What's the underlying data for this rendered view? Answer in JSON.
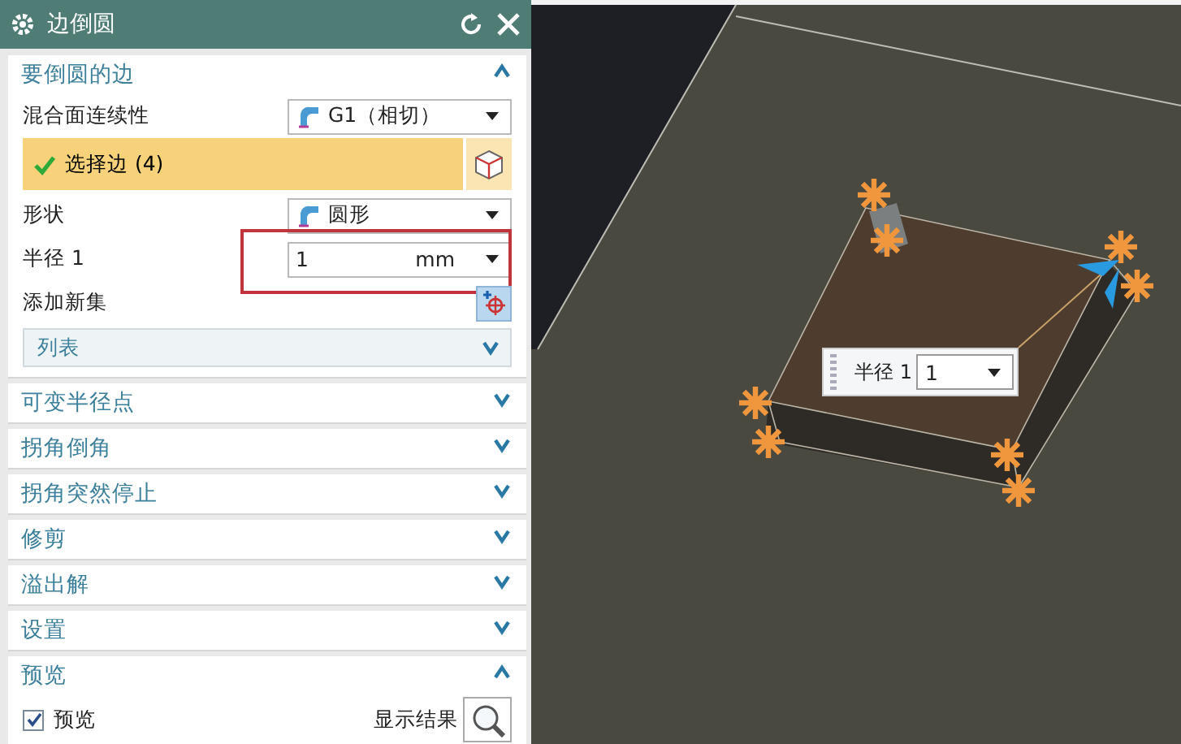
{
  "window": {
    "title": "边倒圆"
  },
  "sections": [
    {
      "title": "要倒圆的边",
      "expanded": true,
      "rows": [
        {
          "kind": "dropdown",
          "label": "混合面连续性",
          "value": "G1（相切）"
        },
        {
          "kind": "selection",
          "label": "选择边 (4)",
          "complete": true
        },
        {
          "kind": "dropdown",
          "label": "形状",
          "value": "圆形"
        },
        {
          "kind": "measure",
          "label": "半径 1",
          "value": "1",
          "unit": "mm",
          "highlighted": true
        },
        {
          "kind": "add",
          "label": "添加新集"
        },
        {
          "kind": "list",
          "label": "列表",
          "expanded": false
        }
      ]
    },
    {
      "title": "可变半径点",
      "expanded": false
    },
    {
      "title": "拐角倒角",
      "expanded": false
    },
    {
      "title": "拐角突然停止",
      "expanded": false
    },
    {
      "title": "修剪",
      "expanded": false
    },
    {
      "title": "溢出解",
      "expanded": false
    },
    {
      "title": "设置",
      "expanded": false
    },
    {
      "title": "预览",
      "expanded": true,
      "rows": [
        {
          "kind": "checkbox",
          "label": "预览",
          "checked": true
        },
        {
          "kind": "action",
          "label": "显示结果"
        }
      ]
    }
  ],
  "viewport": {
    "radius_label": {
      "label": "半径 1",
      "value": "1"
    }
  }
}
